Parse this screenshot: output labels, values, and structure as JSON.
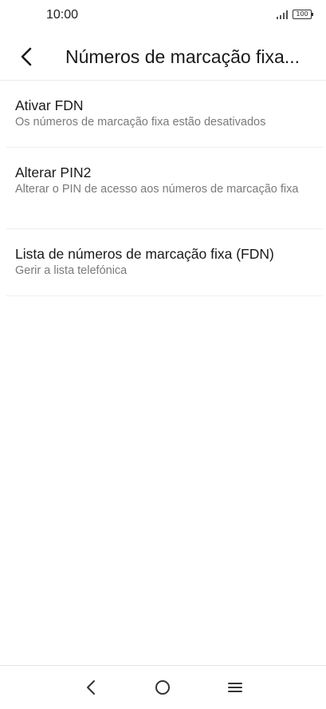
{
  "status_bar": {
    "time": "10:00",
    "battery": "100"
  },
  "app_bar": {
    "title": "Números de marcação fixa..."
  },
  "items": [
    {
      "title": "Ativar FDN",
      "subtitle": "Os números de marcação fixa estão desativados"
    },
    {
      "title": "Alterar PIN2",
      "subtitle": "Alterar o PIN de acesso aos números de marcação fixa"
    },
    {
      "title": "Lista de números de marcação fixa (FDN)",
      "subtitle": "Gerir a lista telefónica"
    }
  ],
  "icons": {
    "back": "back-arrow-icon",
    "nav_back": "nav-back-icon",
    "nav_home": "nav-home-icon",
    "nav_menu": "nav-menu-icon"
  },
  "colors": {
    "title": "#1a1a1a",
    "subtitle": "#7a7a7a",
    "divider": "#eeeeee"
  }
}
